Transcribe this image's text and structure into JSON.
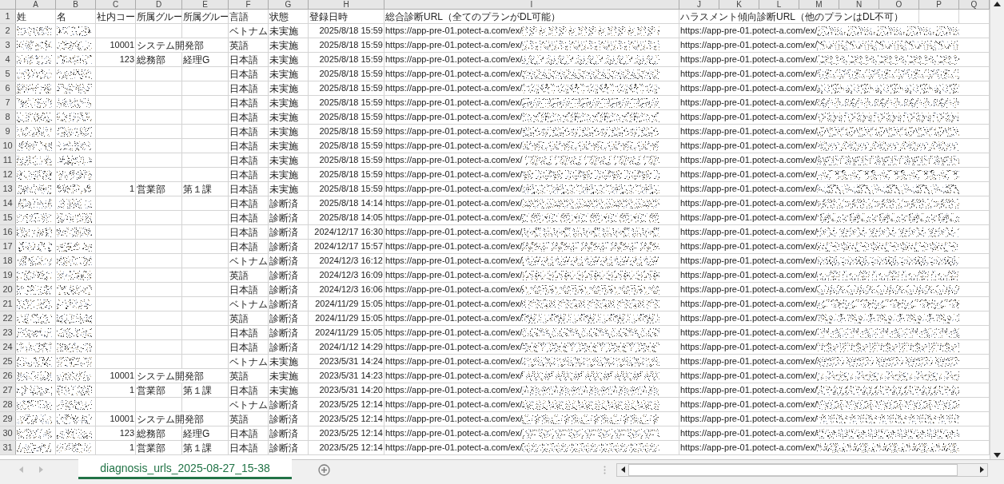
{
  "columns": [
    "A",
    "B",
    "C",
    "D",
    "E",
    "F",
    "G",
    "H",
    "I",
    "J",
    "K",
    "L",
    "M",
    "N",
    "O",
    "P",
    "Q"
  ],
  "header_row": {
    "number": "1",
    "cells": [
      "姓",
      "名",
      "社内コー",
      "所属グルー",
      "所属グルー",
      "言語",
      "状態",
      "登録日時",
      "総合診断URL（全てのプランがDL可能）",
      "ハラスメント傾向診断URL（他のプランはDL不可）"
    ]
  },
  "rows": [
    {
      "number": "2",
      "language": "ベトナム",
      "status": "未実施",
      "registered": "2025/8/18 15:59",
      "url_general": "https://app-pre-01.potect-a.com/ex/",
      "url_harassment": "https://app-pre-01.potect-a.com/ex/"
    },
    {
      "number": "3",
      "code": "10001",
      "group": "システム開発部",
      "language": "英語",
      "status": "未実施",
      "registered": "2025/8/18 15:59",
      "url_general": "https://app-pre-01.potect-a.com/ex/",
      "url_harassment": "https://app-pre-01.potect-a.com/ex/"
    },
    {
      "number": "4",
      "code": "123",
      "group": "総務部",
      "subgroup": "経理G",
      "language": "日本語",
      "status": "未実施",
      "registered": "2025/8/18 15:59",
      "url_general": "https://app-pre-01.potect-a.com/ex/",
      "url_harassment": "https://app-pre-01.potect-a.com/ex/"
    },
    {
      "number": "5",
      "language": "日本語",
      "status": "未実施",
      "registered": "2025/8/18 15:59",
      "url_general": "https://app-pre-01.potect-a.com/ex/",
      "url_harassment": "https://app-pre-01.potect-a.com/ex/"
    },
    {
      "number": "6",
      "language": "日本語",
      "status": "未実施",
      "registered": "2025/8/18 15:59",
      "url_general": "https://app-pre-01.potect-a.com/ex/",
      "url_harassment": "https://app-pre-01.potect-a.com/ex/"
    },
    {
      "number": "7",
      "language": "日本語",
      "status": "未実施",
      "registered": "2025/8/18 15:59",
      "url_general": "https://app-pre-01.potect-a.com/ex/",
      "url_harassment": "https://app-pre-01.potect-a.com/ex/"
    },
    {
      "number": "8",
      "language": "日本語",
      "status": "未実施",
      "registered": "2025/8/18 15:59",
      "url_general": "https://app-pre-01.potect-a.com/ex/",
      "url_harassment": "https://app-pre-01.potect-a.com/ex/"
    },
    {
      "number": "9",
      "language": "日本語",
      "status": "未実施",
      "registered": "2025/8/18 15:59",
      "url_general": "https://app-pre-01.potect-a.com/ex/",
      "url_harassment": "https://app-pre-01.potect-a.com/ex/"
    },
    {
      "number": "10",
      "language": "日本語",
      "status": "未実施",
      "registered": "2025/8/18 15:59",
      "url_general": "https://app-pre-01.potect-a.com/ex/",
      "url_harassment": "https://app-pre-01.potect-a.com/ex/"
    },
    {
      "number": "11",
      "language": "日本語",
      "status": "未実施",
      "registered": "2025/8/18 15:59",
      "url_general": "https://app-pre-01.potect-a.com/ex/",
      "url_harassment": "https://app-pre-01.potect-a.com/ex/"
    },
    {
      "number": "12",
      "language": "日本語",
      "status": "未実施",
      "registered": "2025/8/18 15:59",
      "url_general": "https://app-pre-01.potect-a.com/ex/",
      "url_harassment": "https://app-pre-01.potect-a.com/ex/"
    },
    {
      "number": "13",
      "code": "1",
      "group": "営業部",
      "subgroup": "第１課",
      "language": "日本語",
      "status": "未実施",
      "registered": "2025/8/18 15:59",
      "url_general": "https://app-pre-01.potect-a.com/ex/",
      "url_harassment": "https://app-pre-01.potect-a.com/ex/"
    },
    {
      "number": "14",
      "language": "日本語",
      "status": "診断済",
      "registered": "2025/8/18 14:14",
      "url_general": "https://app-pre-01.potect-a.com/ex/",
      "url_harassment": "https://app-pre-01.potect-a.com/ex/"
    },
    {
      "number": "15",
      "language": "日本語",
      "status": "診断済",
      "registered": "2025/8/18 14:05",
      "url_general": "https://app-pre-01.potect-a.com/ex/",
      "url_harassment": "https://app-pre-01.potect-a.com/ex/"
    },
    {
      "number": "16",
      "language": "日本語",
      "status": "診断済",
      "registered": "2024/12/17 16:30",
      "url_general": "https://app-pre-01.potect-a.com/ex/",
      "url_harassment": "https://app-pre-01.potect-a.com/ex/"
    },
    {
      "number": "17",
      "language": "日本語",
      "status": "診断済",
      "registered": "2024/12/17 15:57",
      "url_general": "https://app-pre-01.potect-a.com/ex/",
      "url_harassment": "https://app-pre-01.potect-a.com/ex/"
    },
    {
      "number": "18",
      "language": "ベトナム",
      "status": "診断済",
      "registered": "2024/12/3 16:12",
      "url_general": "https://app-pre-01.potect-a.com/ex/",
      "url_harassment": "https://app-pre-01.potect-a.com/ex/"
    },
    {
      "number": "19",
      "language": "英語",
      "status": "診断済",
      "registered": "2024/12/3 16:09",
      "url_general": "https://app-pre-01.potect-a.com/ex/",
      "url_harassment": "https://app-pre-01.potect-a.com/ex/"
    },
    {
      "number": "20",
      "language": "日本語",
      "status": "診断済",
      "registered": "2024/12/3 16:06",
      "url_general": "https://app-pre-01.potect-a.com/ex/",
      "url_harassment": "https://app-pre-01.potect-a.com/ex/"
    },
    {
      "number": "21",
      "language": "ベトナム",
      "status": "診断済",
      "registered": "2024/11/29 15:05",
      "url_general": "https://app-pre-01.potect-a.com/ex/",
      "url_harassment": "https://app-pre-01.potect-a.com/ex/"
    },
    {
      "number": "22",
      "language": "英語",
      "status": "診断済",
      "registered": "2024/11/29 15:05",
      "url_general": "https://app-pre-01.potect-a.com/ex/",
      "url_harassment": "https://app-pre-01.potect-a.com/ex/"
    },
    {
      "number": "23",
      "language": "日本語",
      "status": "診断済",
      "registered": "2024/11/29 15:05",
      "url_general": "https://app-pre-01.potect-a.com/ex/",
      "url_harassment": "https://app-pre-01.potect-a.com/ex/"
    },
    {
      "number": "24",
      "language": "日本語",
      "status": "診断済",
      "registered": "2024/1/12 14:29",
      "url_general": "https://app-pre-01.potect-a.com/ex/",
      "url_harassment": "https://app-pre-01.potect-a.com/ex/"
    },
    {
      "number": "25",
      "language": "ベトナム",
      "status": "未実施",
      "registered": "2023/5/31 14:24",
      "url_general": "https://app-pre-01.potect-a.com/ex/",
      "url_harassment": "https://app-pre-01.potect-a.com/ex/"
    },
    {
      "number": "26",
      "code": "10001",
      "group": "システム開発部",
      "language": "英語",
      "status": "未実施",
      "registered": "2023/5/31 14:23",
      "url_general": "https://app-pre-01.potect-a.com/ex/",
      "url_harassment": "https://app-pre-01.potect-a.com/ex/"
    },
    {
      "number": "27",
      "code": "1",
      "group": "営業部",
      "subgroup": "第１課",
      "language": "日本語",
      "status": "未実施",
      "registered": "2023/5/31 14:20",
      "url_general": "https://app-pre-01.potect-a.com/ex/",
      "url_harassment": "https://app-pre-01.potect-a.com/ex/"
    },
    {
      "number": "28",
      "language": "ベトナム",
      "status": "診断済",
      "registered": "2023/5/25 12:14",
      "url_general": "https://app-pre-01.potect-a.com/ex/",
      "url_harassment": "https://app-pre-01.potect-a.com/ex/"
    },
    {
      "number": "29",
      "code": "10001",
      "group": "システム開発部",
      "language": "英語",
      "status": "診断済",
      "registered": "2023/5/25 12:14",
      "url_general": "https://app-pre-01.potect-a.com/ex/",
      "url_harassment": "https://app-pre-01.potect-a.com/ex/"
    },
    {
      "number": "30",
      "code": "123",
      "group": "総務部",
      "subgroup": "経理G",
      "language": "日本語",
      "status": "診断済",
      "registered": "2023/5/25 12:14",
      "url_general": "https://app-pre-01.potect-a.com/ex/",
      "url_harassment": "https://app-pre-01.potect-a.com/ex/"
    },
    {
      "number": "31",
      "code": "1",
      "group": "営業部",
      "subgroup": "第１課",
      "language": "日本語",
      "status": "診断済",
      "registered": "2023/5/25 12:14",
      "url_general": "https://app-pre-01.potect-a.com/ex/",
      "url_harassment": "https://app-pre-01.potect-a.com/ex/"
    }
  ],
  "sheet_tabs": [
    {
      "label": "diagnosis_urls_2025-08-27_15-38",
      "selected": true
    }
  ]
}
